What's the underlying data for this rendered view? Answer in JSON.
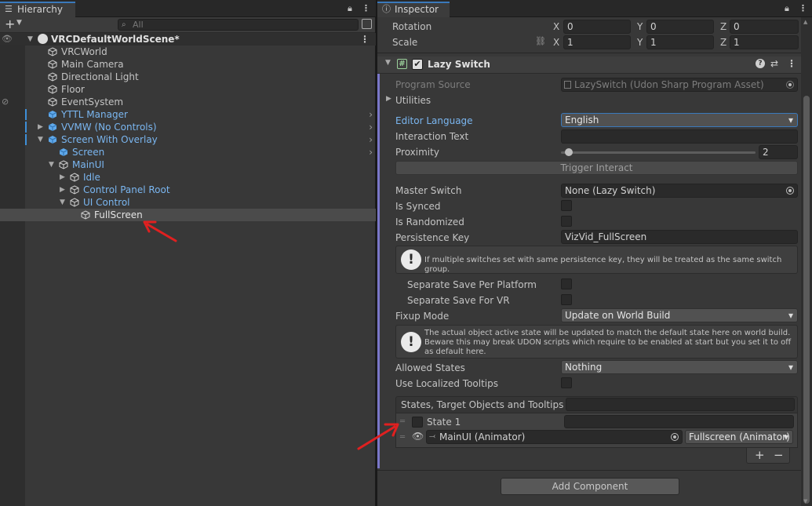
{
  "hierarchy": {
    "tab_label": "Hierarchy",
    "search_placeholder": "All",
    "scene_name": "VRCDefaultWorldScene*",
    "items": [
      {
        "label": "VRCWorld"
      },
      {
        "label": "Main Camera"
      },
      {
        "label": "Directional Light"
      },
      {
        "label": "Floor"
      },
      {
        "label": "EventSystem"
      },
      {
        "label": "YTTL Manager"
      },
      {
        "label": "VVMW (No Controls)"
      },
      {
        "label": "Screen With Overlay"
      },
      {
        "label": "Screen"
      },
      {
        "label": "MainUI"
      },
      {
        "label": "Idle"
      },
      {
        "label": "Control Panel Root"
      },
      {
        "label": "UI Control"
      },
      {
        "label": "FullScreen"
      }
    ]
  },
  "inspector": {
    "tab_label": "Inspector",
    "transform": {
      "rotation_label": "Rotation",
      "scale_label": "Scale",
      "rotation": {
        "x": "0",
        "y": "0",
        "z": "0"
      },
      "scale": {
        "x": "1",
        "y": "1",
        "z": "1"
      },
      "axis_x": "X",
      "axis_y": "Y",
      "axis_z": "Z"
    },
    "component": {
      "title": "Lazy Switch",
      "program_source_label": "Program Source",
      "program_source_value": "LazySwitch (Udon Sharp Program Asset)",
      "utilities_label": "Utilities",
      "editor_language_label": "Editor Language",
      "editor_language_value": "English",
      "interaction_text_label": "Interaction Text",
      "interaction_text_value": "",
      "proximity_label": "Proximity",
      "proximity_value": "2",
      "proximity_fraction": 0.02,
      "trigger_interact_label": "Trigger Interact",
      "master_switch_label": "Master Switch",
      "master_switch_value": "None (Lazy Switch)",
      "is_synced_label": "Is Synced",
      "is_randomized_label": "Is Randomized",
      "persistence_key_label": "Persistence Key",
      "persistence_key_value": "VizVid_FullScreen",
      "persistence_help": "If multiple switches set with same persistence key, they will be treated as the same switch group.",
      "separate_save_platform_label": "Separate Save Per Platform",
      "separate_save_vr_label": "Separate Save For VR",
      "fixup_mode_label": "Fixup Mode",
      "fixup_mode_value": "Update on World Build",
      "fixup_help": "The actual object active state will be updated to match the default state here on world build. Beware this may break UDON scripts which require to be enabled at start but you set it to off as default here.",
      "allowed_states_label": "Allowed States",
      "allowed_states_value": "Nothing",
      "localized_tooltips_label": "Use Localized Tooltips",
      "states_header": "States, Target Objects and Tooltips",
      "state1_label": "State 1",
      "target_object": "MainUI (Animator)",
      "target_type": "Fullscreen (Animator)",
      "plus_label": "+",
      "minus_label": "−"
    },
    "add_component_label": "Add Component"
  },
  "colors": {
    "panel": "#383838",
    "accent_blue": "#7ab6f0",
    "selection": "#4b4b4b",
    "annotation_red": "#e02020"
  }
}
